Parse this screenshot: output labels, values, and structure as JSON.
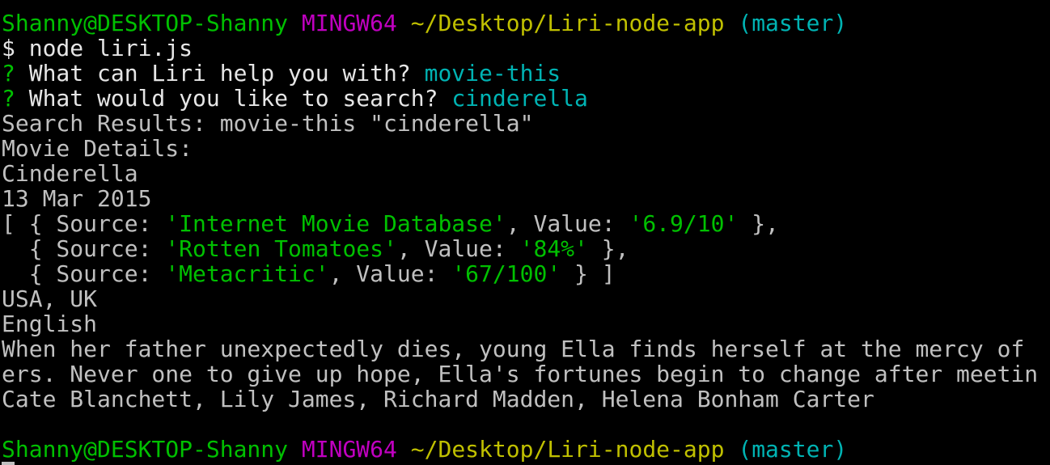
{
  "prompt": {
    "user_host": "Shanny@DESKTOP-Shanny",
    "system": "MINGW64",
    "path": "~/Desktop/Liri-node-app",
    "branch": "(master)"
  },
  "command": {
    "symbol": "$",
    "text": "node liri.js"
  },
  "questions": [
    {
      "mark": "?",
      "text": "What can Liri help you with?",
      "answer": "movie-this"
    },
    {
      "mark": "?",
      "text": "What would you like to search?",
      "answer": "cinderella"
    }
  ],
  "output": {
    "search_results": "Search Results: movie-this \"cinderella\"",
    "movie_details": "Movie Details:",
    "title": "Cinderella",
    "released": "13 Mar 2015",
    "ratings": [
      {
        "source": "Internet Movie Database",
        "value": "6.9/10"
      },
      {
        "source": "Rotten Tomatoes",
        "value": "84%"
      },
      {
        "source": "Metacritic",
        "value": "67/100"
      }
    ],
    "country": "USA, UK",
    "language": "English",
    "plot_line_1": "When her father unexpectedly dies, young Ella finds herself at the mercy of",
    "plot_line_2": "ers. Never one to give up hope, Ella's fortunes begin to change after meetin",
    "actors": "Cate Blanchett, Lily James, Richard Madden, Helena Bonham Carter"
  },
  "colors": {
    "background": "#000000",
    "default_text": "#c0c0c0",
    "prompt_user": "#00c000",
    "prompt_system": "#c000c0",
    "prompt_path": "#c0c000",
    "prompt_branch": "#00b3b3",
    "answer": "#00b3b3",
    "string": "#00c000"
  }
}
